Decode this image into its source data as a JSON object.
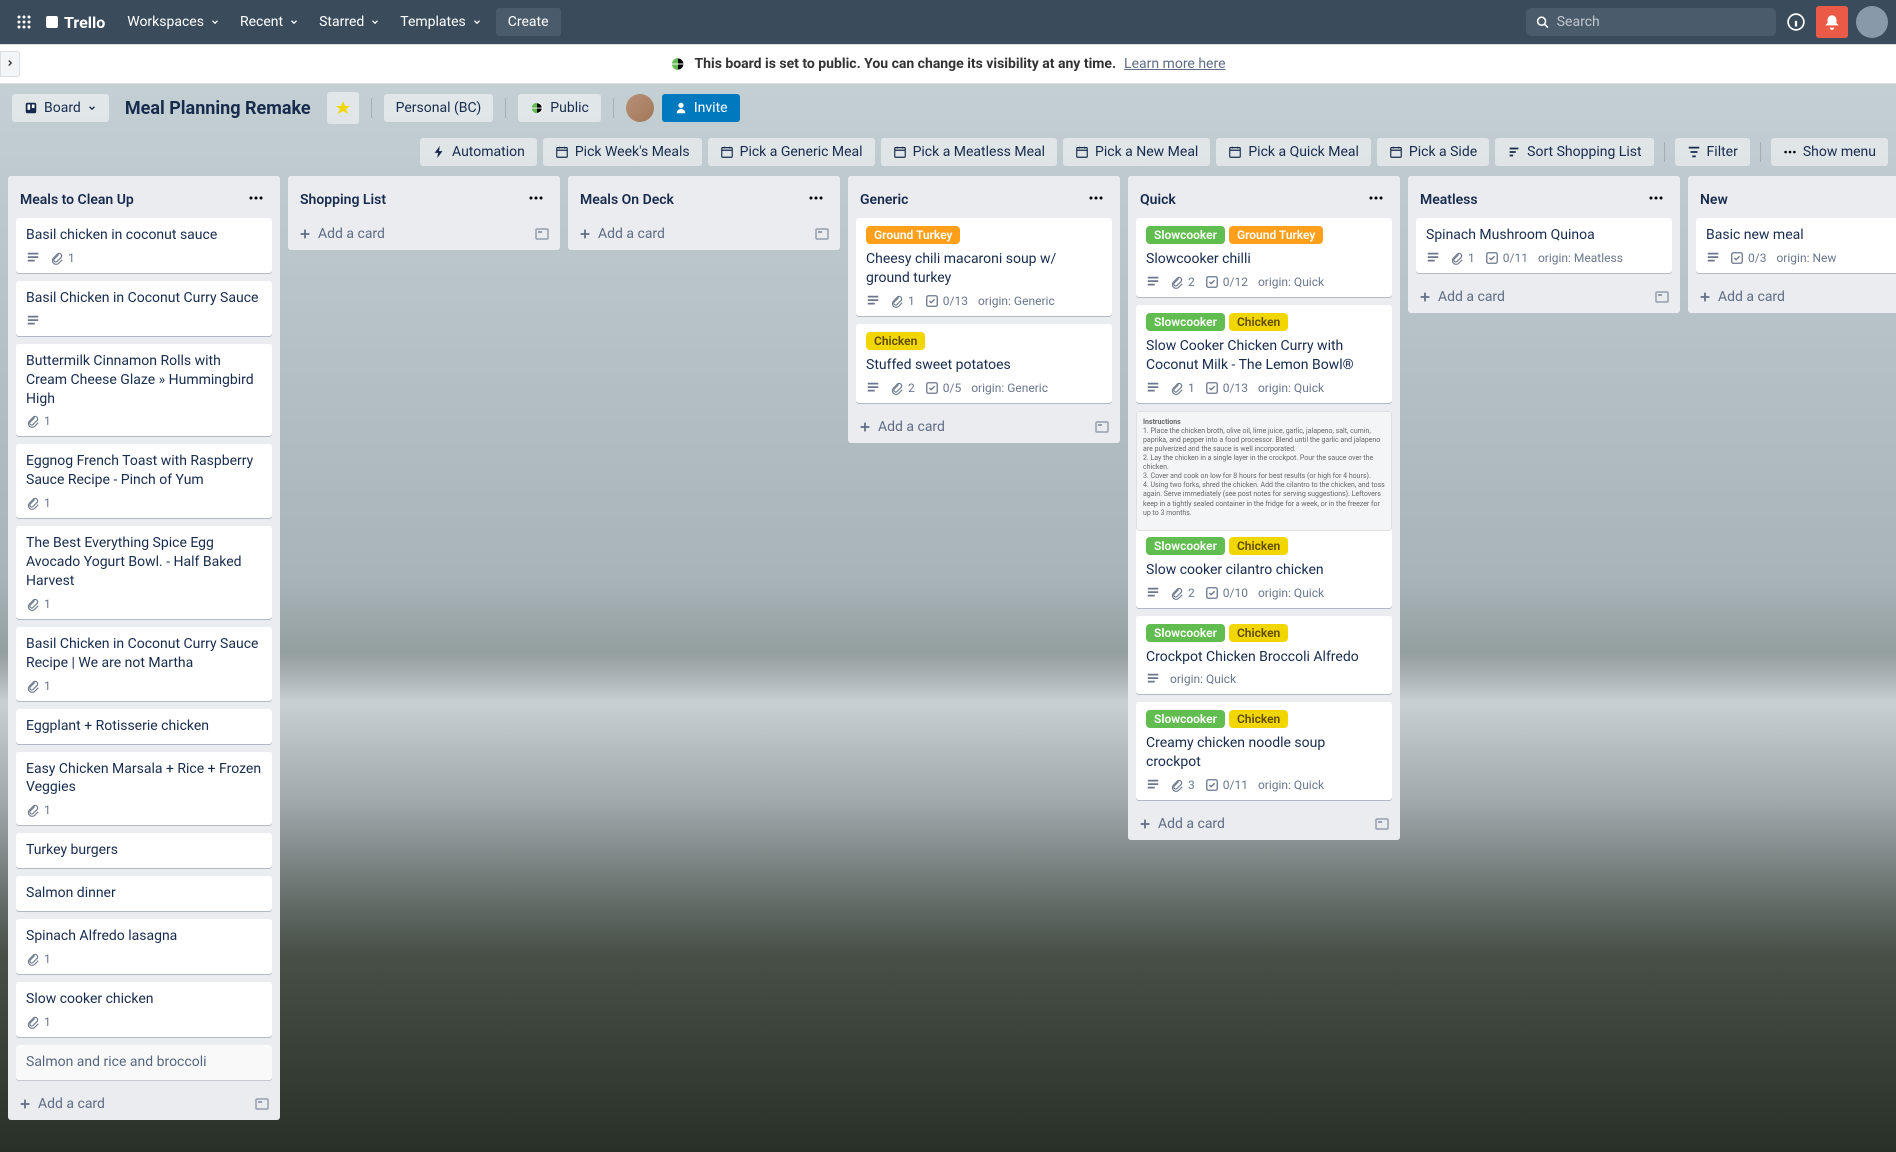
{
  "nav": {
    "logo": "Trello",
    "workspaces": "Workspaces",
    "recent": "Recent",
    "starred": "Starred",
    "templates": "Templates",
    "create": "Create",
    "search_placeholder": "Search"
  },
  "banner": {
    "text": "This board is set to public. You can change its visibility at any time.",
    "link": "Learn more here"
  },
  "board_header": {
    "view": "Board",
    "title": "Meal Planning Remake",
    "workspace": "Personal (BC)",
    "visibility": "Public",
    "invite": "Invite"
  },
  "butler": {
    "automation": "Automation",
    "b1": "Pick Week's Meals",
    "b2": "Pick a Generic Meal",
    "b3": "Pick a Meatless Meal",
    "b4": "Pick a New Meal",
    "b5": "Pick a Quick Meal",
    "b6": "Pick a Side",
    "b7": "Sort Shopping List",
    "filter": "Filter",
    "show_menu": "Show menu"
  },
  "add_card": "Add a card",
  "lists": {
    "l0": {
      "title": "Meals to Clean Up"
    },
    "l1": {
      "title": "Shopping List"
    },
    "l2": {
      "title": "Meals On Deck"
    },
    "l3": {
      "title": "Generic"
    },
    "l4": {
      "title": "Quick"
    },
    "l5": {
      "title": "Meatless"
    },
    "l6": {
      "title": "New"
    }
  },
  "cards": {
    "c0_0": {
      "title": "Basil chicken in coconut sauce",
      "att": "1"
    },
    "c0_1": {
      "title": "Basil Chicken in Coconut Curry Sauce"
    },
    "c0_2": {
      "title": "Buttermilk Cinnamon Rolls with Cream Cheese Glaze » Hummingbird High",
      "att": "1"
    },
    "c0_3": {
      "title": "Eggnog French Toast with Raspberry Sauce Recipe - Pinch of Yum",
      "att": "1"
    },
    "c0_4": {
      "title": "The Best Everything Spice Egg Avocado Yogurt Bowl.   - Half Baked Harvest",
      "att": "1"
    },
    "c0_5": {
      "title": "Basil Chicken in Coconut Curry Sauce Recipe | We are not Martha",
      "att": "1"
    },
    "c0_6": {
      "title": "Eggplant + Rotisserie chicken"
    },
    "c0_7": {
      "title": "Easy Chicken Marsala + Rice + Frozen Veggies",
      "att": "1"
    },
    "c0_8": {
      "title": "Turkey burgers"
    },
    "c0_9": {
      "title": "Salmon dinner"
    },
    "c0_10": {
      "title": "Spinach Alfredo lasagna",
      "att": "1"
    },
    "c0_11": {
      "title": "Slow cooker chicken",
      "att": "1"
    },
    "c0_12": {
      "title": "Salmon and rice and broccoli"
    },
    "c3_0": {
      "title": "Cheesy chili macaroni soup w/ ground turkey",
      "lbl1": "Ground Turkey",
      "att": "1",
      "check": "0/13",
      "origin": "origin: Generic"
    },
    "c3_1": {
      "title": "Stuffed sweet potatoes",
      "lbl1": "Chicken",
      "att": "2",
      "check": "0/5",
      "origin": "origin: Generic"
    },
    "c4_0": {
      "title": "Slowcooker chilli",
      "lbl1": "Slowcooker",
      "lbl2": "Ground Turkey",
      "att": "2",
      "check": "0/12",
      "origin": "origin: Quick"
    },
    "c4_1": {
      "title": "Slow Cooker Chicken Curry with Coconut Milk - The Lemon Bowl®",
      "lbl1": "Slowcooker",
      "lbl2": "Chicken",
      "att": "1",
      "check": "0/13",
      "origin": "origin: Quick"
    },
    "c4_2": {
      "title": "Slow cooker cilantro chicken",
      "lbl1": "Slowcooker",
      "lbl2": "Chicken",
      "att": "2",
      "check": "0/10",
      "origin": "origin: Quick"
    },
    "c4_3": {
      "title": "Crockpot Chicken Broccoli Alfredo",
      "lbl1": "Slowcooker",
      "lbl2": "Chicken",
      "origin": "origin: Quick"
    },
    "c4_4": {
      "title": "Creamy chicken noodle soup crockpot",
      "lbl1": "Slowcooker",
      "lbl2": "Chicken",
      "att": "3",
      "check": "0/11",
      "origin": "origin: Quick"
    },
    "c5_0": {
      "title": "Spinach Mushroom Quinoa",
      "att": "1",
      "check": "0/11",
      "origin": "origin: Meatless"
    },
    "c6_0": {
      "title": "Basic new meal",
      "check": "0/3",
      "origin": "origin: New"
    }
  }
}
